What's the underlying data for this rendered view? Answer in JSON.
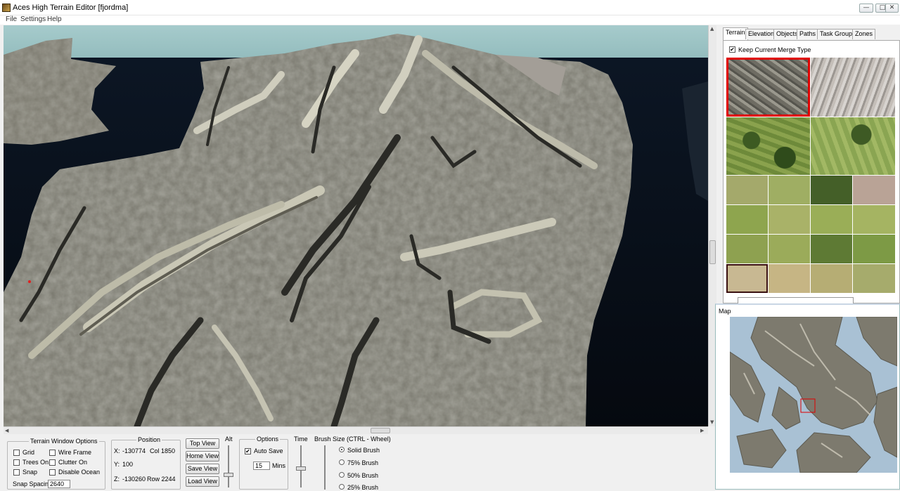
{
  "window": {
    "title": "Aces High Terrain Editor [fjordma]",
    "min_glyph": "—",
    "max_glyph": "□",
    "close_glyph": "✕"
  },
  "menu": {
    "items": [
      {
        "label": "File"
      },
      {
        "label": "Settings"
      },
      {
        "label": "Help"
      }
    ]
  },
  "tabs": [
    {
      "label": "Terrain",
      "active": true
    },
    {
      "label": "Elevations"
    },
    {
      "label": "Objects"
    },
    {
      "label": "Paths"
    },
    {
      "label": "Task Groups"
    },
    {
      "label": "Zones"
    }
  ],
  "terrain_panel": {
    "keep_merge_label": "Keep Current Merge Type",
    "keep_merge_checked": true,
    "check_glyph": "✔"
  },
  "map_panel": {
    "title": "Map"
  },
  "terrain_window_options": {
    "title": "Terrain Window Options",
    "grid": "Grid",
    "wire_frame": "Wire Frame",
    "trees_on": "Trees On",
    "clutter_on": "Clutter On",
    "snap": "Snap",
    "disable_ocean": "Disable Ocean",
    "snap_spacing_label": "Snap Spacing",
    "snap_spacing_value": "2640"
  },
  "position": {
    "title": "Position",
    "x_label": "X:",
    "x_value": "-130774",
    "col_value": "Col 1850",
    "y_label": "Y:",
    "y_value": "100",
    "z_label": "Z:",
    "z_value": "-130260",
    "row_value": "Row 2244"
  },
  "view_buttons": {
    "top": "Top View",
    "home": "Home View",
    "save": "Save View",
    "load": "Load View"
  },
  "alt": {
    "label": "Alt"
  },
  "options": {
    "title": "Options",
    "auto_save_label": "Auto Save",
    "auto_save_checked": true,
    "mins_value": "15",
    "mins_label": "Mins"
  },
  "time": {
    "label": "Time"
  },
  "brush": {
    "title": "Brush Size (CTRL - Wheel)",
    "solid": "Solid Brush",
    "b75": "75% Brush",
    "b50": "50% Brush",
    "b25": "25% Brush",
    "selected": "solid"
  },
  "colors": {
    "selection": "#e00000",
    "water": "#0a1420",
    "sky": "#9dc3c3"
  }
}
